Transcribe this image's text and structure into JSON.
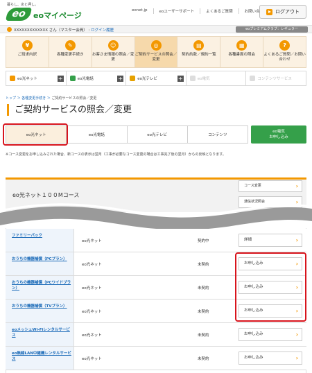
{
  "header": {
    "tagline": "暮らし、あと押し。",
    "logo_mark": "eo",
    "site_name": "eoマイページ",
    "topnav": [
      "eonet.jp",
      "eoユーザーサポート",
      "よくあるご質問",
      "お問い合わせ"
    ],
    "logout_label": "ログアウト"
  },
  "userbar": {
    "user_name": "XXXXXXXXXXXXX さん（マスター会員）",
    "login_history": "ログイン履歴",
    "premium": "eoプレミアムクラブ：レギュラー"
  },
  "main_menu": [
    {
      "icon": "¥",
      "label": "ご請求内訳"
    },
    {
      "icon": "✎",
      "label": "各種変更手続き"
    },
    {
      "icon": "☺",
      "label": "お客さま情報の照会／変更"
    },
    {
      "icon": "◎",
      "label": "ご契約サービスの照会／変更"
    },
    {
      "icon": "▤",
      "label": "契約約款／規約一覧"
    },
    {
      "icon": "▦",
      "label": "各種書面の照会"
    },
    {
      "icon": "?",
      "label": "よくあるご質問／お問い合わせ"
    }
  ],
  "service_tabs": [
    {
      "label": "eo光ネット",
      "color": "#f39800",
      "enabled": true
    },
    {
      "label": "eo光電話",
      "color": "#35a04a",
      "enabled": true
    },
    {
      "label": "eo光テレビ",
      "color": "#e6a100",
      "enabled": true
    },
    {
      "label": "eo電気",
      "color": "#cccccc",
      "enabled": false
    },
    {
      "label": "コンテンツサービス",
      "color": "#cccccc",
      "enabled": false
    }
  ],
  "breadcrumb": {
    "items": [
      "トップ",
      "各種変更手続き"
    ],
    "current": "ご契約サービスの照会／変更"
  },
  "page_title": "ご契約サービスの照会／変更",
  "content_tabs": [
    "eo光ネット",
    "eo光電話",
    "eo光テレビ",
    "コンテンツ"
  ],
  "apply_button": "eo電気\nお申し込み",
  "note": "※コース変更をお申し込みされた場合、新コースの表示は翌月（工事が必要なコース変更の場合は工事完了後の翌月）からの反映となります。",
  "course": {
    "title": "eo光ネット１００Mコース",
    "buttons": [
      "コース変更",
      "通信状況照会"
    ]
  },
  "table_rows": [
    {
      "name": "ファミリーパック",
      "service": "eo光ネット",
      "status": "契約中",
      "action": "詳細"
    },
    {
      "name": "おうちの機器補償（PCプラン）",
      "service": "eo光ネット",
      "status": "未契約",
      "action": "お申し込み"
    },
    {
      "name": "おうちの機器補償（PCワイドプラン）",
      "service": "eo光ネット",
      "status": "未契約",
      "action": "お申し込み"
    },
    {
      "name": "おうちの機器補償（TVプラン）",
      "service": "eo光ネット",
      "status": "未契約",
      "action": "お申し込み"
    },
    {
      "name": "eoメッシュWi-Fiレンタルサービス",
      "service": "eo光ネット",
      "status": "未契約",
      "action": "お申し込み"
    },
    {
      "name": "eo無線LAN中継機レンタルサービス",
      "service": "eo光ネット",
      "status": "未契約",
      "action": "お申し込み"
    }
  ],
  "colors": {
    "accent": "#f39800",
    "highlight": "#d8141c",
    "green": "#35a04a",
    "link": "#1a6ab8"
  }
}
